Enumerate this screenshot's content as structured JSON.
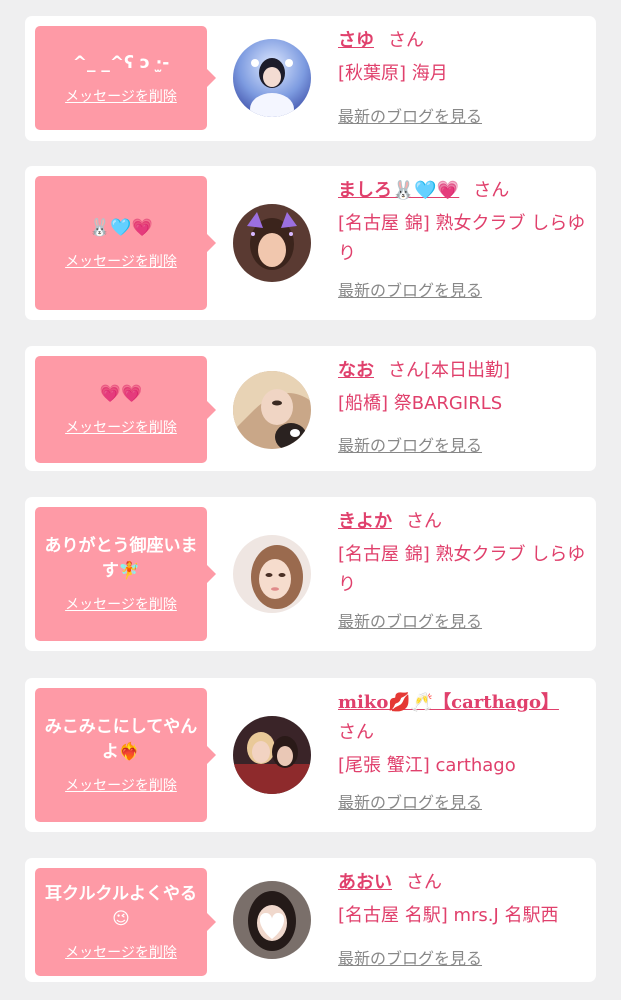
{
  "common": {
    "delete_label": "メッセージを削除",
    "san_label": "さん",
    "blog_label": "最新のブログを見る"
  },
  "colors": {
    "bubble": "#fe9aa6",
    "accent": "#e0406c",
    "link_gray": "#888888",
    "background": "#efeff0"
  },
  "messages": [
    {
      "message": "^_ _^ʕ ɔ ·̫-",
      "name": "さゆ",
      "name_suffix": "",
      "shop": "[秋葉原] 海月"
    },
    {
      "message": "🐰🩵💗",
      "name": "ましろ🐰🩵💗",
      "name_suffix": "",
      "shop": "[名古屋 錦] 熟女クラブ しらゆり"
    },
    {
      "message": "💗💗",
      "name": "なお",
      "name_suffix": "[本日出勤]",
      "shop": "[船橋] 祭BARGIRLS"
    },
    {
      "message": "ありがとう御座います🧚",
      "name": "きよか",
      "name_suffix": "",
      "shop": "[名古屋 錦] 熟女クラブ しらゆり"
    },
    {
      "message": "みこみこにしてやんよ❤️‍🔥",
      "name": "miko💋🥂【carthago】",
      "name_suffix": "",
      "shop": "[尾張 蟹江] carthago"
    },
    {
      "message": "耳クルクルよくやる😉",
      "name": "あおい",
      "name_suffix": "",
      "shop": "[名古屋 名駅] mrs.J 名駅西"
    }
  ]
}
